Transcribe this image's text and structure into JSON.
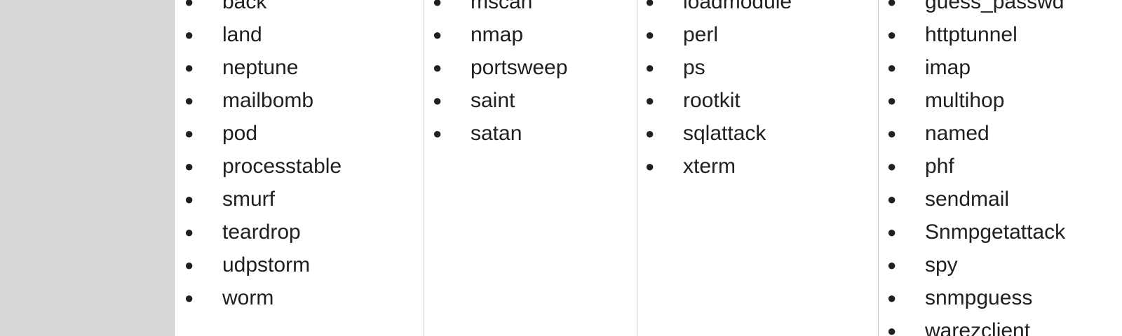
{
  "columns": [
    {
      "items": [
        "back",
        "land",
        "neptune",
        "mailbomb",
        "pod",
        "processtable",
        "smurf",
        "teardrop",
        "udpstorm",
        "worm"
      ]
    },
    {
      "items": [
        "mscan",
        "nmap",
        "portsweep",
        "saint",
        "satan"
      ]
    },
    {
      "items": [
        "loadmodule",
        "perl",
        "ps",
        "rootkit",
        "sqlattack",
        "xterm"
      ]
    },
    {
      "items": [
        "guess_passwd",
        "httptunnel",
        "imap",
        "multihop",
        "named",
        "phf",
        "sendmail",
        "Snmpgetattack",
        "spy",
        "snmpguess",
        "warezclient"
      ]
    }
  ],
  "bullet_glyph": "●"
}
